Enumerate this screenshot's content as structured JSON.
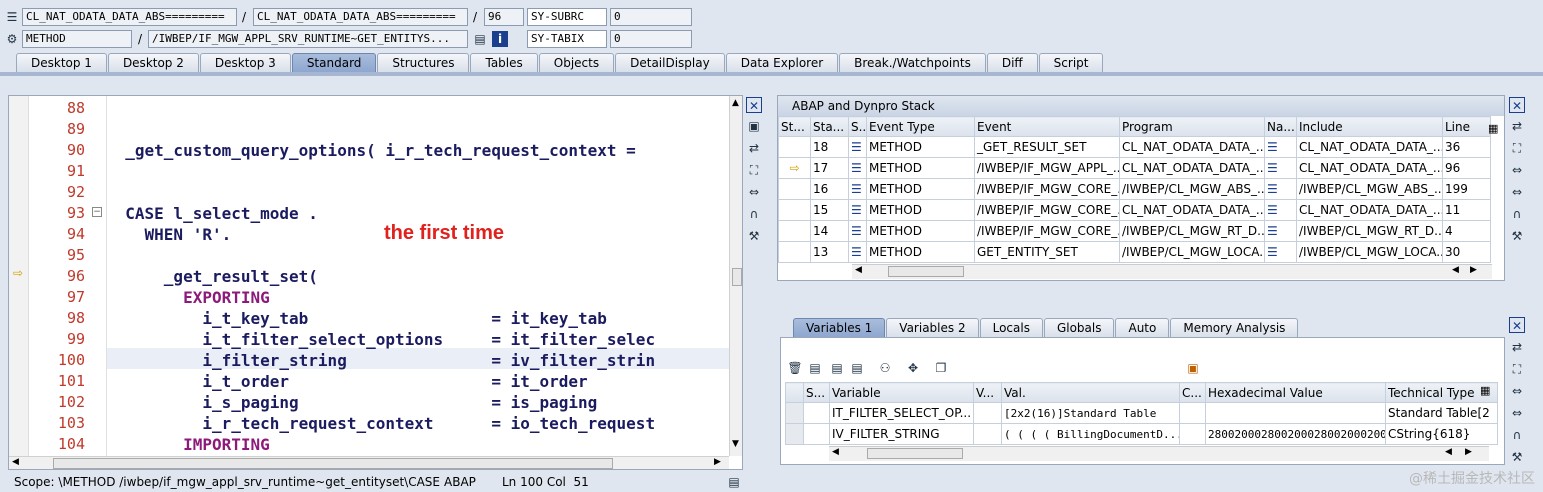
{
  "header": {
    "row1": {
      "field1": "CL_NAT_ODATA_DATA_ABS=========",
      "field2": "CL_NAT_ODATA_DATA_ABS=========",
      "sep1": "/",
      "sep2": "/",
      "number": "96",
      "sysvar": "SY-SUBRC",
      "sysval": "0"
    },
    "row2": {
      "field1": "METHOD",
      "field2": "/IWBEP/IF_MGW_APPL_SRV_RUNTIME~GET_ENTITYS...",
      "sep1": "/",
      "sysvar": "SY-TABIX",
      "sysval": "0"
    }
  },
  "tabs": [
    "Desktop 1",
    "Desktop 2",
    "Desktop 3",
    "Standard",
    "Structures",
    "Tables",
    "Objects",
    "DetailDisplay",
    "Data Explorer",
    "Break./Watchpoints",
    "Diff",
    "Script"
  ],
  "active_tab": "Standard",
  "editor": {
    "lines": [
      {
        "n": "88",
        "code": ""
      },
      {
        "n": "89",
        "code": ""
      },
      {
        "n": "90",
        "code": "  _get_custom_query_options( i_r_tech_request_context = "
      },
      {
        "n": "91",
        "code": ""
      },
      {
        "n": "92",
        "code": ""
      },
      {
        "n": "93",
        "code": "  CASE l_select_mode ."
      },
      {
        "n": "94",
        "code": "    WHEN 'R'."
      },
      {
        "n": "95",
        "code": ""
      },
      {
        "n": "96",
        "code": "      _get_result_set("
      },
      {
        "n": "97",
        "code": "        EXPORTING"
      },
      {
        "n": "98",
        "code": "          i_t_key_tab                   = it_key_tab"
      },
      {
        "n": "99",
        "code": "          i_t_filter_select_options     = it_filter_selec"
      },
      {
        "n": "100",
        "code": "          i_filter_string               = iv_filter_strin"
      },
      {
        "n": "101",
        "code": "          i_t_order                     = it_order"
      },
      {
        "n": "102",
        "code": "          i_s_paging                    = is_paging"
      },
      {
        "n": "103",
        "code": "          i_r_tech_request_context      = io_tech_request"
      },
      {
        "n": "104",
        "code": "        IMPORTING"
      }
    ],
    "annotation": "the first time"
  },
  "status": {
    "scope": "Scope: \\METHOD /iwbep/if_mgw_appl_srv_runtime~get_entityset\\CASE",
    "lang": "ABAP",
    "pos": "Ln 100 Col  51"
  },
  "stack": {
    "title": "ABAP and Dynpro Stack",
    "columns": [
      "St...",
      "Sta...",
      "S...",
      "Event Type",
      "Event",
      "Program",
      "Na...",
      "Include",
      "Line"
    ],
    "rows": [
      {
        "level": "18",
        "type": "METHOD",
        "event": "_GET_RESULT_SET",
        "program": "CL_NAT_ODATA_DATA_...",
        "include": "CL_NAT_ODATA_DATA_...",
        "line": "36",
        "current": false
      },
      {
        "level": "17",
        "type": "METHOD",
        "event": "/IWBEP/IF_MGW_APPL_...",
        "program": "CL_NAT_ODATA_DATA_...",
        "include": "CL_NAT_ODATA_DATA_...",
        "line": "96",
        "current": true
      },
      {
        "level": "16",
        "type": "METHOD",
        "event": "/IWBEP/IF_MGW_CORE_...",
        "program": "/IWBEP/CL_MGW_ABS_...",
        "include": "/IWBEP/CL_MGW_ABS_...",
        "line": "199",
        "current": false
      },
      {
        "level": "15",
        "type": "METHOD",
        "event": "/IWBEP/IF_MGW_CORE_...",
        "program": "CL_NAT_ODATA_DATA_...",
        "include": "CL_NAT_ODATA_DATA_...",
        "line": "11",
        "current": false
      },
      {
        "level": "14",
        "type": "METHOD",
        "event": "/IWBEP/IF_MGW_CORE_...",
        "program": "/IWBEP/CL_MGW_RT_D...",
        "include": "/IWBEP/CL_MGW_RT_D...",
        "line": "4",
        "current": false
      },
      {
        "level": "13",
        "type": "METHOD",
        "event": "GET_ENTITY_SET",
        "program": "/IWBEP/CL_MGW_LOCA...",
        "include": "/IWBEP/CL_MGW_LOCA...",
        "line": "30",
        "current": false
      }
    ]
  },
  "var_tabs": [
    "Variables 1",
    "Variables 2",
    "Locals",
    "Globals",
    "Auto",
    "Memory Analysis"
  ],
  "variables": {
    "columns": [
      "S...",
      "Variable",
      "V...",
      "Val.",
      "C...",
      "Hexadecimal Value",
      "Technical Type"
    ],
    "rows": [
      {
        "name": "IT_FILTER_SELECT_OP...",
        "value": "[2x2(16)]Standard Table",
        "hex": "",
        "type": "Standard Table[2"
      },
      {
        "name": "IV_FILTER_STRING",
        "value": "( ( ( ( BillingDocumentD...",
        "hex": "2800200028002000280020002000",
        "type": "CString{618}"
      }
    ]
  },
  "watermark": "@稀土掘金技术社区"
}
